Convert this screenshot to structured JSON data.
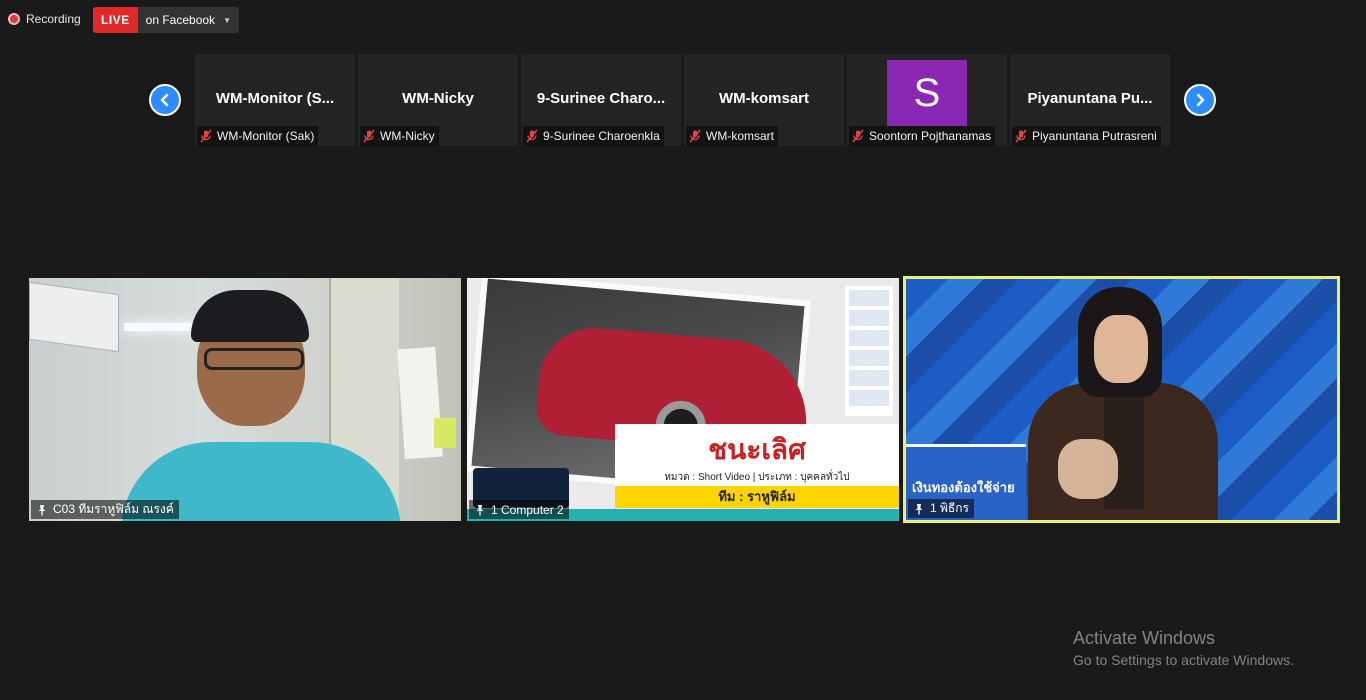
{
  "recording": {
    "label": "Recording"
  },
  "live": {
    "badge": "LIVE",
    "target": "on Facebook"
  },
  "strip": {
    "participants": [
      {
        "display": "WM-Monitor  (S...",
        "label": "WM-Monitor (Sak)",
        "avatar": ""
      },
      {
        "display": "WM-Nicky",
        "label": "WM-Nicky",
        "avatar": ""
      },
      {
        "display": "9-Surinee  Charo...",
        "label": "9-Surinee Charoenkla",
        "avatar": ""
      },
      {
        "display": "WM-komsart",
        "label": "WM-komsart",
        "avatar": ""
      },
      {
        "display": "",
        "label": "Soontorn Pojthanamas",
        "avatar": "S"
      },
      {
        "display": "Piyanuntana  Pu...",
        "label": "Piyanuntana Putrasreni",
        "avatar": ""
      }
    ]
  },
  "videos": [
    {
      "name": "C03 ทีมราหูฟิล์ม ณรงค์"
    },
    {
      "name": "1 Computer 2",
      "title": "ชนะเลิศ",
      "subtitle": "หมวด : Short Video | ประเภท : บุคคลทั่วไป",
      "team": "ทีม : ราหูฟิล์ม"
    },
    {
      "name": "1 พิธีกร",
      "board": "เงินทองต้องใช้จ่าย"
    }
  ],
  "watermark": {
    "title": "Activate Windows",
    "subtitle": "Go to Settings to activate Windows."
  },
  "colors": {
    "live": "#e02a2a",
    "nav": "#2d8cff",
    "active_speaker": "#e8f07a",
    "avatar": "#8a27b3"
  }
}
